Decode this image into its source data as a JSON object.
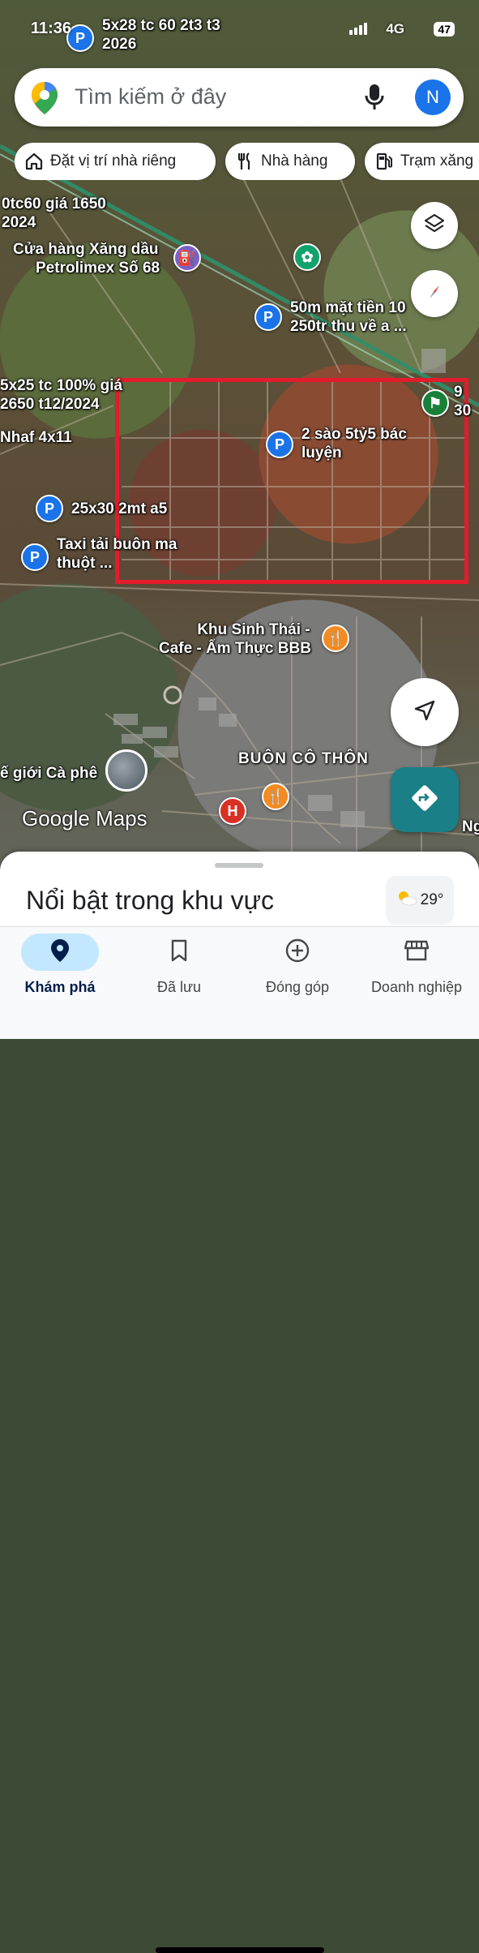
{
  "status_bar": {
    "time": "11:36",
    "network": "4G",
    "battery": "47"
  },
  "search": {
    "placeholder": "Tìm kiếm ở đây",
    "avatar_letter": "N"
  },
  "chips": [
    {
      "label": "Đặt vị trí nhà riêng",
      "icon": "home-icon"
    },
    {
      "label": "Nhà hàng",
      "icon": "restaurant-icon"
    },
    {
      "label": "Trạm xăng",
      "icon": "gas-station-icon"
    }
  ],
  "map_labels": {
    "top_pin_l1": "5x28 tc 60 2t3 t3",
    "top_pin_l2": "2026",
    "left_edge_l1": "0tc60 giá 1650",
    "left_edge_l2": "2024",
    "gas_station_l1": "Cửa hàng Xăng dầu",
    "gas_station_l2": "Petrolimex Số 68",
    "road_pin_l1": "50m mặt tiền 10",
    "road_pin_l2": "250tr thu về a ...",
    "left_mid_l1": "5x25 tc 100% giá",
    "left_mid_l2": "2650 t12/2024",
    "left_nhaf": "Nhaf 4x11",
    "right_edge_l1": "9",
    "right_edge_l2": "30",
    "center_pin_l1": "2 sào 5tỷ5 bác",
    "center_pin_l2": "luyện",
    "pin_25x30": "25x30 2mt a5",
    "taxi_l1": "Taxi tải buôn ma",
    "taxi_l2": "thuột ...",
    "eco_l1": "Khu Sinh Thái -",
    "eco_l2": "Cafe - Ẩm Thực BBB",
    "village": "BUÔN CÔ THÔN",
    "coffee_world": "ế giới Cà phê",
    "right_bottom": "Ng",
    "google_maps": "Google Maps",
    "hospital_letter": "H"
  },
  "sheet": {
    "title": "Nổi bật trong khu vực",
    "temperature": "29°"
  },
  "bottom_nav": [
    {
      "label": "Khám phá",
      "icon": "explore-pin-icon",
      "active": true
    },
    {
      "label": "Đã lưu",
      "icon": "bookmark-icon",
      "active": false
    },
    {
      "label": "Đóng góp",
      "icon": "add-circle-icon",
      "active": false
    },
    {
      "label": "Doanh nghiệp",
      "icon": "storefront-icon",
      "active": false
    }
  ],
  "colors": {
    "highlight_box": "#e31b2c",
    "pin_blue": "#1a73e8",
    "directions_fab": "#1a7f86",
    "active_tab": "#c2e7ff"
  }
}
